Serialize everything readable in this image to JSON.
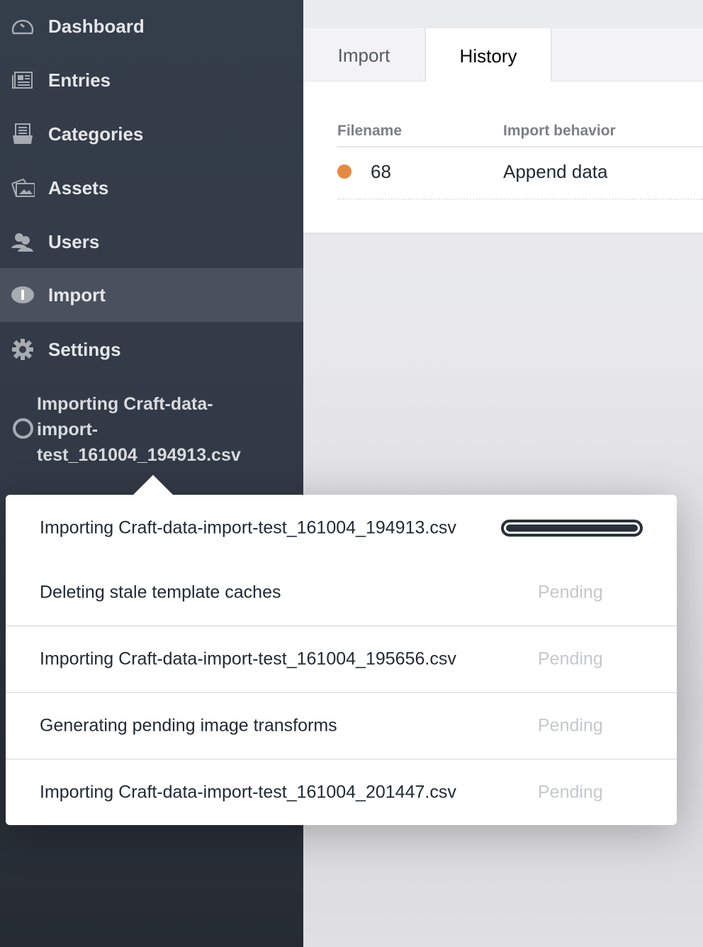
{
  "sidebar": {
    "items": [
      {
        "label": "Dashboard",
        "icon": "dashboard-icon"
      },
      {
        "label": "Entries",
        "icon": "entries-icon"
      },
      {
        "label": "Categories",
        "icon": "categories-icon"
      },
      {
        "label": "Assets",
        "icon": "assets-icon"
      },
      {
        "label": "Users",
        "icon": "users-icon"
      },
      {
        "label": "Import",
        "icon": "import-icon",
        "active": true
      },
      {
        "label": "Settings",
        "icon": "gear-icon"
      }
    ],
    "job": "Importing Craft-data-import-test_161004_194913.csv"
  },
  "tabs": [
    {
      "label": "Import"
    },
    {
      "label": "History",
      "active": true
    }
  ],
  "table": {
    "headers": [
      "Filename",
      "Import behavior"
    ],
    "rows": [
      {
        "status_color": "#e48a42",
        "filename": "68",
        "behavior": "Append data"
      }
    ]
  },
  "popup": {
    "tasks": [
      {
        "label": "Importing Craft-data-import-test_161004_194913.csv",
        "progress": 1.0
      },
      {
        "label": "Deleting stale template caches",
        "status": "Pending"
      },
      {
        "label": "Importing Craft-data-import-test_161004_195656.csv",
        "status": "Pending"
      },
      {
        "label": "Generating pending image transforms",
        "status": "Pending"
      },
      {
        "label": "Importing Craft-data-import-test_161004_201447.csv",
        "status": "Pending"
      }
    ]
  }
}
